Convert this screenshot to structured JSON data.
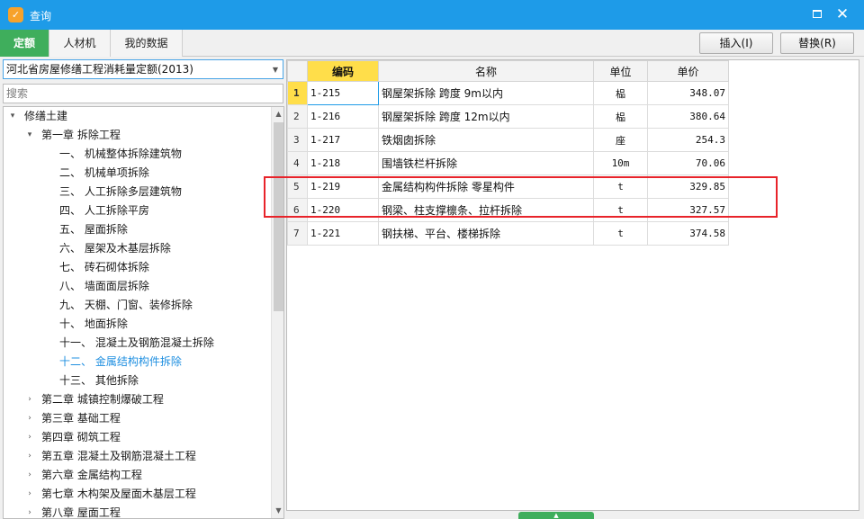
{
  "window": {
    "title": "查询",
    "app_icon": "app-logo-icon",
    "max_icon": "maximize-icon",
    "close_icon": "close-icon",
    "accent": "#1e9be8"
  },
  "tabs": [
    {
      "label": "定额",
      "active": true
    },
    {
      "label": "人材机",
      "active": false
    },
    {
      "label": "我的数据",
      "active": false
    }
  ],
  "actions": {
    "insert_label": "插入(I)",
    "replace_label": "替换(R)"
  },
  "dataset": {
    "selected": "河北省房屋修缮工程消耗量定额(2013)"
  },
  "search": {
    "placeholder": "搜索",
    "value": ""
  },
  "tree": [
    {
      "label": "修缮土建",
      "level": 0,
      "expander": "▾"
    },
    {
      "label": "第一章 拆除工程",
      "level": 1,
      "expander": "▾"
    },
    {
      "label": "一、 机械整体拆除建筑物",
      "level": 2
    },
    {
      "label": "二、 机械单项拆除",
      "level": 2
    },
    {
      "label": "三、 人工拆除多层建筑物",
      "level": 2
    },
    {
      "label": "四、 人工拆除平房",
      "level": 2
    },
    {
      "label": "五、 屋面拆除",
      "level": 2
    },
    {
      "label": "六、 屋架及木基层拆除",
      "level": 2
    },
    {
      "label": "七、 砖石砌体拆除",
      "level": 2
    },
    {
      "label": "八、 墙面面层拆除",
      "level": 2
    },
    {
      "label": "九、 天棚、门窗、装修拆除",
      "level": 2
    },
    {
      "label": "十、 地面拆除",
      "level": 2
    },
    {
      "label": "十一、 混凝土及钢筋混凝土拆除",
      "level": 2
    },
    {
      "label": "十二、 金属结构构件拆除",
      "level": 2,
      "selected": true
    },
    {
      "label": "十三、 其他拆除",
      "level": 2
    },
    {
      "label": "第二章 城镇控制爆破工程",
      "level": 1,
      "expander": "›"
    },
    {
      "label": "第三章 基础工程",
      "level": 1,
      "expander": "›"
    },
    {
      "label": "第四章 砌筑工程",
      "level": 1,
      "expander": "›"
    },
    {
      "label": "第五章 混凝土及钢筋混凝土工程",
      "level": 1,
      "expander": "›"
    },
    {
      "label": "第六章 金属结构工程",
      "level": 1,
      "expander": "›"
    },
    {
      "label": "第七章 木构架及屋面木基层工程",
      "level": 1,
      "expander": "›"
    },
    {
      "label": "第八章 屋面工程",
      "level": 1,
      "expander": "›"
    }
  ],
  "grid": {
    "columns": [
      "编码",
      "名称",
      "单位",
      "单价"
    ],
    "rows": [
      {
        "index": "1",
        "code": "1-215",
        "name": "钢屋架拆除 跨度 9m以内",
        "unit": "榀",
        "price": "348.07"
      },
      {
        "index": "2",
        "code": "1-216",
        "name": "钢屋架拆除 跨度 12m以内",
        "unit": "榀",
        "price": "380.64"
      },
      {
        "index": "3",
        "code": "1-217",
        "name": "铁烟囱拆除",
        "unit": "座",
        "price": "254.3"
      },
      {
        "index": "4",
        "code": "1-218",
        "name": "围墙铁栏杆拆除",
        "unit": "10m",
        "price": "70.06"
      },
      {
        "index": "5",
        "code": "1-219",
        "name": "金属结构构件拆除 零星构件",
        "unit": "t",
        "price": "329.85"
      },
      {
        "index": "6",
        "code": "1-220",
        "name": "钢梁、柱支撑檩条、拉杆拆除",
        "unit": "t",
        "price": "327.57"
      },
      {
        "index": "7",
        "code": "1-221",
        "name": "钢扶梯、平台、楼梯拆除",
        "unit": "t",
        "price": "374.58"
      }
    ]
  },
  "icons": {
    "scroll_up": "scroll-up-icon",
    "scroll_down": "scroll-down-icon",
    "select_arrow": "chevron-down-icon",
    "splitter": "chevron-up-icon"
  },
  "colors": {
    "tab_active": "#3fae5c",
    "header_selected": "#ffde4a",
    "highlight_box": "#e8232a",
    "tree_selected": "#1f8fe0"
  }
}
